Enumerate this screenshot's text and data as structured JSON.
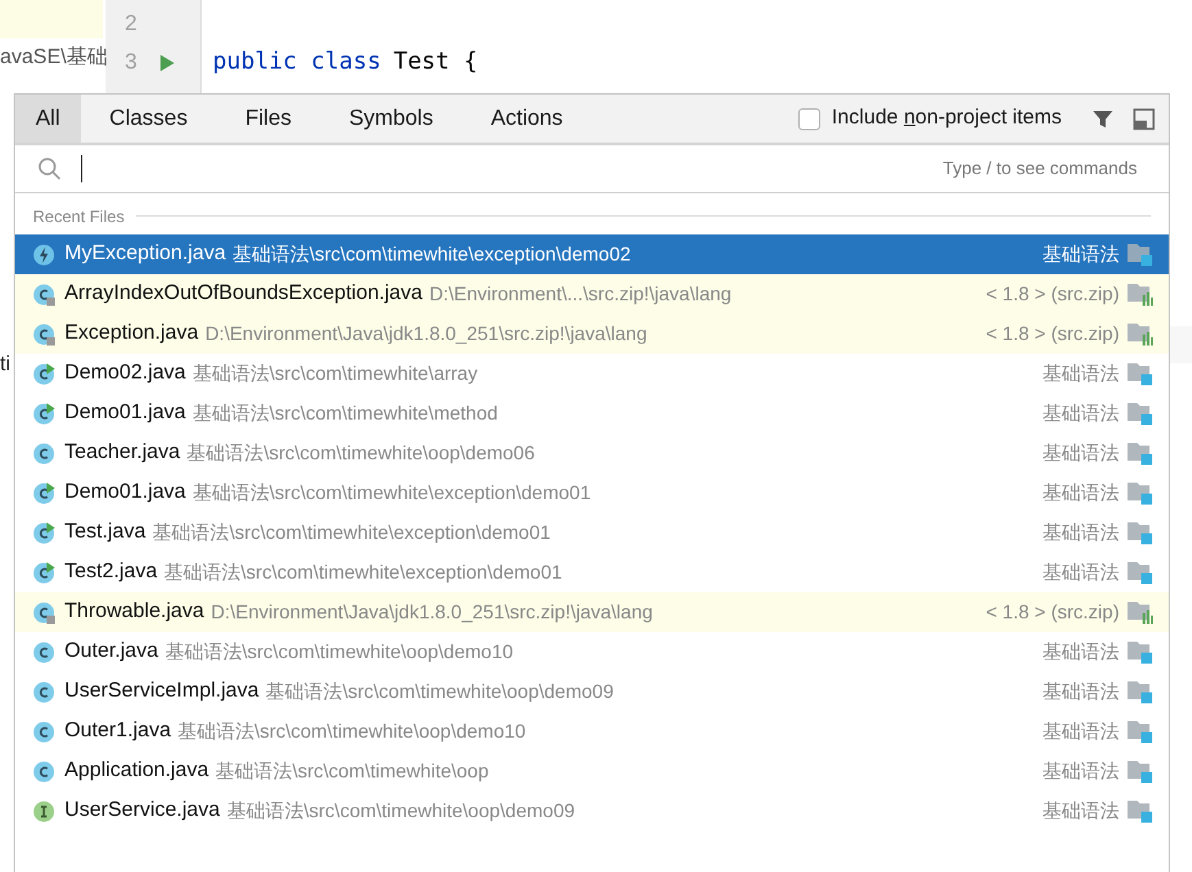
{
  "editor": {
    "project_path": "avaSE\\基础",
    "project_fragment": "ti",
    "lines": [
      {
        "number": "2",
        "runnable": false
      },
      {
        "number": "3",
        "runnable": true
      }
    ],
    "code_tokens": [
      {
        "kind": "keyword",
        "text": "public class"
      },
      {
        "kind": "plain",
        "text": "Test {"
      }
    ]
  },
  "popup": {
    "tabs": [
      {
        "label": "All",
        "selected": true
      },
      {
        "label": "Classes",
        "selected": false
      },
      {
        "label": "Files",
        "selected": false
      },
      {
        "label": "Symbols",
        "selected": false
      },
      {
        "label": "Actions",
        "selected": false
      }
    ],
    "include_checkbox": {
      "label_before": "Include ",
      "mnemonic": "n",
      "label_after": "on-project items",
      "checked": false
    },
    "search": {
      "hint": "Type / to see commands"
    },
    "section": "Recent Files",
    "rows": [
      {
        "kind": "exception",
        "name": "MyException.java",
        "path": "基础语法\\src\\com\\timewhite\\exception\\demo02",
        "location": "基础语法",
        "selected": true
      },
      {
        "kind": "library",
        "name": "ArrayIndexOutOfBoundsException.java",
        "path": "D:\\Environment\\...\\src.zip!\\java\\lang",
        "location": "< 1.8 > (src.zip)",
        "selected": false
      },
      {
        "kind": "library",
        "name": "Exception.java",
        "path": "D:\\Environment\\Java\\jdk1.8.0_251\\src.zip!\\java\\lang",
        "location": "< 1.8 > (src.zip)",
        "selected": false
      },
      {
        "kind": "runnable",
        "name": "Demo02.java",
        "path": "基础语法\\src\\com\\timewhite\\array",
        "location": "基础语法",
        "selected": false
      },
      {
        "kind": "runnable",
        "name": "Demo01.java",
        "path": "基础语法\\src\\com\\timewhite\\method",
        "location": "基础语法",
        "selected": false
      },
      {
        "kind": "class",
        "name": "Teacher.java",
        "path": "基础语法\\src\\com\\timewhite\\oop\\demo06",
        "location": "基础语法",
        "selected": false
      },
      {
        "kind": "runnable",
        "name": "Demo01.java",
        "path": "基础语法\\src\\com\\timewhite\\exception\\demo01",
        "location": "基础语法",
        "selected": false
      },
      {
        "kind": "runnable",
        "name": "Test.java",
        "path": "基础语法\\src\\com\\timewhite\\exception\\demo01",
        "location": "基础语法",
        "selected": false
      },
      {
        "kind": "runnable",
        "name": "Test2.java",
        "path": "基础语法\\src\\com\\timewhite\\exception\\demo01",
        "location": "基础语法",
        "selected": false
      },
      {
        "kind": "library",
        "name": "Throwable.java",
        "path": "D:\\Environment\\Java\\jdk1.8.0_251\\src.zip!\\java\\lang",
        "location": "< 1.8 > (src.zip)",
        "selected": false
      },
      {
        "kind": "class",
        "name": "Outer.java",
        "path": "基础语法\\src\\com\\timewhite\\oop\\demo10",
        "location": "基础语法",
        "selected": false
      },
      {
        "kind": "class",
        "name": "UserServiceImpl.java",
        "path": "基础语法\\src\\com\\timewhite\\oop\\demo09",
        "location": "基础语法",
        "selected": false
      },
      {
        "kind": "class",
        "name": "Outer1.java",
        "path": "基础语法\\src\\com\\timewhite\\oop\\demo10",
        "location": "基础语法",
        "selected": false
      },
      {
        "kind": "class",
        "name": "Application.java",
        "path": "基础语法\\src\\com\\timewhite\\oop",
        "location": "基础语法",
        "selected": false
      },
      {
        "kind": "interface",
        "name": "UserService.java",
        "path": "基础语法\\src\\com\\timewhite\\oop\\demo09",
        "location": "基础语法",
        "selected": false
      }
    ]
  }
}
